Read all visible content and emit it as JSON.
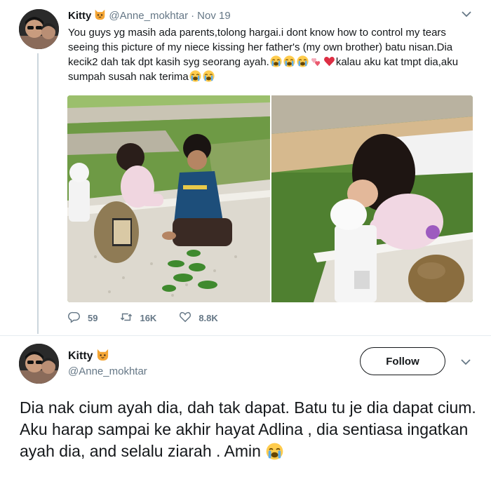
{
  "quoted_tweet": {
    "display_name": "Kitty",
    "name_emoji": "cat-face-emoji",
    "handle": "@Anne_mokhtar",
    "separator": "·",
    "date": "Nov 19",
    "text_part1": "You guys yg masih ada parents,tolong hargai.i dont know how to control my tears seeing this picture of my niece kissing her father's (my own brother) batu nisan.Dia kecik2 dah tak dpt kasih syg seorang ayah.",
    "text_part2": "kalau aku kat tmpt dia,aku sumpah susah nak terima",
    "emoji_run1": [
      "crying-emoji",
      "crying-emoji",
      "crying-emoji",
      "two-hearts-emoji",
      "red-heart-emoji"
    ],
    "emoji_run2": [
      "crying-emoji",
      "crying-emoji"
    ],
    "photos": [
      "grave-photo-children",
      "grave-photo-girl-kissing"
    ],
    "actions": {
      "replies": "59",
      "retweets": "16K",
      "likes": "8.8K"
    }
  },
  "main_tweet": {
    "display_name": "Kitty",
    "name_emoji": "cat-face-emoji",
    "handle": "@Anne_mokhtar",
    "follow_label": "Follow",
    "text": "Dia nak cium ayah dia, dah tak dapat. Batu tu je dia dapat cium. Aku harap sampai ke akhir hayat Adlina , dia sentiasa ingatkan ayah dia, and selalu ziarah . Amin",
    "trailing_emoji": "crying-emoji"
  },
  "colors": {
    "text": "#14171a",
    "secondary": "#657786",
    "divider": "#e6ecf0",
    "heart": "#e0245e"
  }
}
